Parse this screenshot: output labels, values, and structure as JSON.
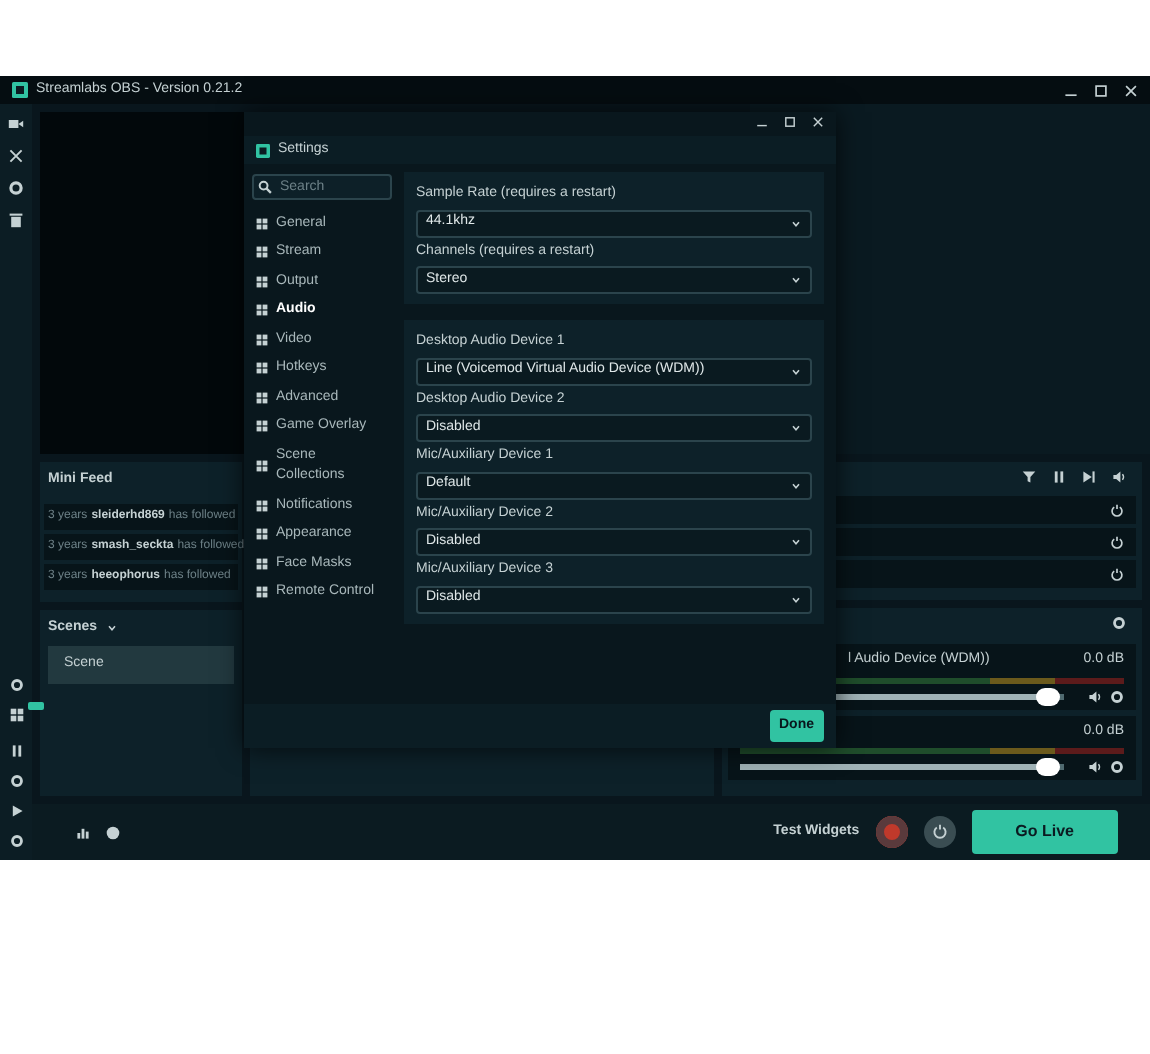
{
  "window": {
    "title": "Streamlabs OBS - Version 0.21.2"
  },
  "mini_feed": {
    "title": "Mini Feed",
    "events": [
      {
        "time": "3 years",
        "user": "sleiderhd869",
        "action": "has followed"
      },
      {
        "time": "3 years",
        "user": "smash_seckta",
        "action": "has followed"
      },
      {
        "time": "3 years",
        "user": "heeophorus",
        "action": "has followed"
      }
    ]
  },
  "scenes": {
    "title": "Scenes",
    "items": [
      {
        "label": "Scene",
        "selected": true
      }
    ]
  },
  "mixer": {
    "items": [
      {
        "name": "l Audio Device (WDM))",
        "reading": "0.0 dB",
        "level": 0.95
      },
      {
        "reading": "0.0 dB",
        "level": 0.95
      }
    ]
  },
  "footer": {
    "test_widgets": "Test Widgets",
    "go_live": "Go Live"
  },
  "settings": {
    "title": "Settings",
    "search": {
      "placeholder": "Search"
    },
    "nav": [
      {
        "label": "General",
        "selected": false
      },
      {
        "label": "Stream",
        "selected": false
      },
      {
        "label": "Output",
        "selected": false
      },
      {
        "label": "Audio",
        "selected": true
      },
      {
        "label": "Video",
        "selected": false
      },
      {
        "label": "Hotkeys",
        "selected": false
      },
      {
        "label": "Advanced",
        "selected": false
      },
      {
        "label": "Game Overlay",
        "selected": false
      },
      {
        "label": "Scene Collections",
        "selected": false
      },
      {
        "label": "Notifications",
        "selected": false
      },
      {
        "label": "Appearance",
        "selected": false
      },
      {
        "label": "Face Masks",
        "selected": false
      },
      {
        "label": "Remote Control",
        "selected": false
      }
    ],
    "sections": [
      {
        "fields": [
          {
            "label": "Sample Rate (requires a restart)",
            "value": "44.1khz"
          },
          {
            "label": "Channels (requires a restart)",
            "value": "Stereo"
          }
        ]
      },
      {
        "fields": [
          {
            "label": "Desktop Audio Device 1",
            "value": "Line (Voicemod Virtual Audio Device (WDM))"
          },
          {
            "label": "Desktop Audio Device 2",
            "value": "Disabled"
          },
          {
            "label": "Mic/Auxiliary Device 1",
            "value": "Default"
          },
          {
            "label": "Mic/Auxiliary Device 2",
            "value": "Disabled"
          },
          {
            "label": "Mic/Auxiliary Device 3",
            "value": "Disabled"
          }
        ]
      }
    ],
    "done": "Done"
  }
}
